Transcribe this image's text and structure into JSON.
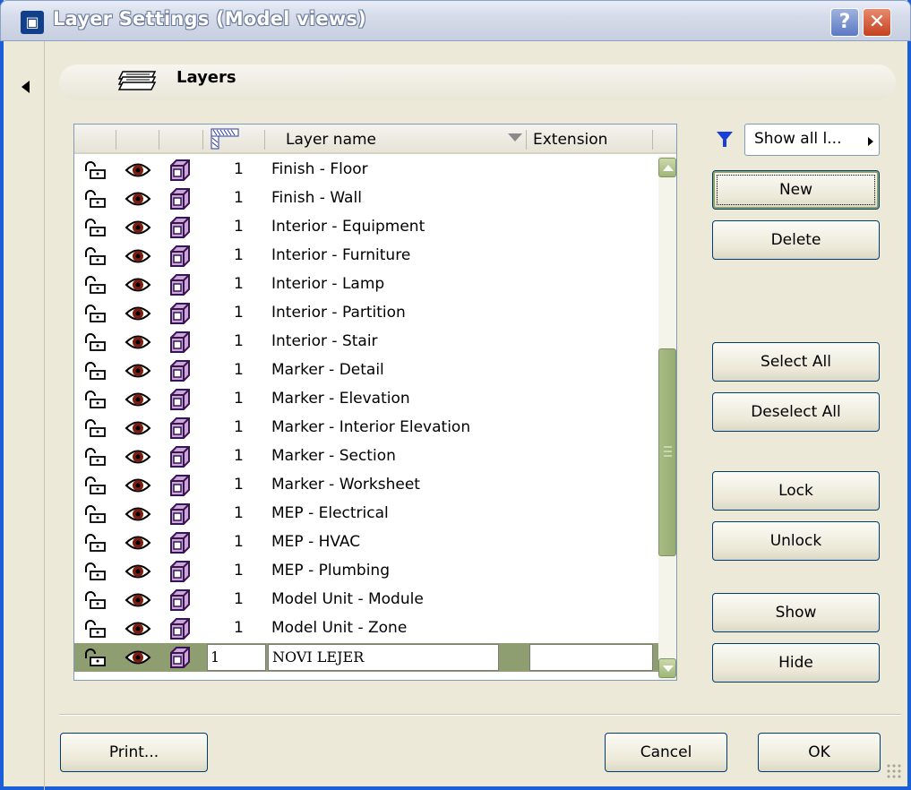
{
  "window": {
    "title": "Layer Settings (Model views)",
    "help_label": "?",
    "close_label": "✕"
  },
  "section": {
    "title": "Layers"
  },
  "list": {
    "columns": {
      "name": "Layer name",
      "extension": "Extension"
    },
    "rows": [
      {
        "num": "1",
        "name": "Finish - Floor"
      },
      {
        "num": "1",
        "name": "Finish - Wall"
      },
      {
        "num": "1",
        "name": "Interior - Equipment"
      },
      {
        "num": "1",
        "name": "Interior - Furniture"
      },
      {
        "num": "1",
        "name": "Interior - Lamp"
      },
      {
        "num": "1",
        "name": "Interior - Partition"
      },
      {
        "num": "1",
        "name": "Interior - Stair"
      },
      {
        "num": "1",
        "name": "Marker - Detail"
      },
      {
        "num": "1",
        "name": "Marker - Elevation"
      },
      {
        "num": "1",
        "name": "Marker - Interior Elevation"
      },
      {
        "num": "1",
        "name": "Marker - Section"
      },
      {
        "num": "1",
        "name": "Marker - Worksheet"
      },
      {
        "num": "1",
        "name": "MEP - Electrical"
      },
      {
        "num": "1",
        "name": "MEP - HVAC"
      },
      {
        "num": "1",
        "name": "MEP - Plumbing"
      },
      {
        "num": "1",
        "name": "Model Unit - Module"
      },
      {
        "num": "1",
        "name": "Model Unit - Zone"
      }
    ],
    "selected_row": {
      "num": "1",
      "name": "NOVI LEJER",
      "extension": ""
    }
  },
  "filter": {
    "label": "Show all l..."
  },
  "buttons": {
    "new": "New",
    "delete": "Delete",
    "select_all": "Select All",
    "deselect_all": "Deselect All",
    "lock": "Lock",
    "unlock": "Unlock",
    "show": "Show",
    "hide": "Hide",
    "print": "Print...",
    "cancel": "Cancel",
    "ok": "OK"
  },
  "colors": {
    "selection": "#8f9e71",
    "scroll_accent": "#9fb678",
    "title_bar": "#c7cfe0",
    "filter_icon": "#1a3fd6"
  }
}
